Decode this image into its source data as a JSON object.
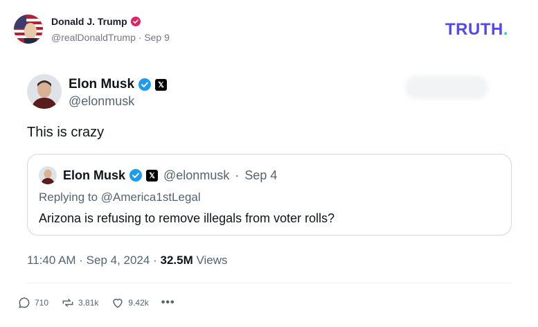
{
  "truth_post": {
    "author_name": "Donald J. Trump",
    "author_handle": "@realDonaldTrump",
    "date": "Sep 9",
    "logo_text": "TRUTH",
    "logo_dot": "."
  },
  "tweet": {
    "author_name": "Elon Musk",
    "author_handle": "@elonmusk",
    "text": "This is crazy",
    "quoted": {
      "author_name": "Elon Musk",
      "author_handle": "@elonmusk",
      "date": "Sep 4",
      "replying_to": "Replying to @America1stLegal",
      "text": "Arizona is refusing to remove illegals from voter rolls?"
    },
    "timestamp": "11:40 AM · Sep 4, 2024 · ",
    "views_count": "32.5M",
    "views_label": " Views"
  },
  "actions": {
    "replies": "710",
    "retruths": "3.81k",
    "likes": "9.42k",
    "more": "•••"
  },
  "colors": {
    "truth_purple": "#5448ee",
    "truth_teal": "#1dd6b4",
    "verified_red": "#e0245e",
    "x_blue_check": "#1d9bf0"
  }
}
